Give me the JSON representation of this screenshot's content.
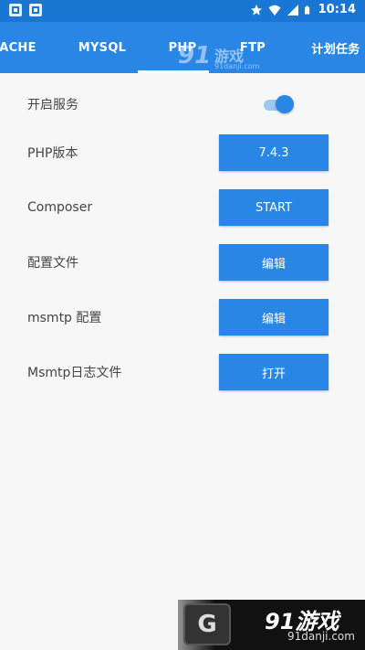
{
  "status_bar": {
    "time": "10:14",
    "notification_icons": [
      "app-notification-icon",
      "app-notification-icon"
    ],
    "right_icons": [
      "star-icon",
      "wifi-icon",
      "signal-icon",
      "battery-icon"
    ]
  },
  "tabs": [
    {
      "label": "APACHE",
      "active": false
    },
    {
      "label": "MYSQL",
      "active": false
    },
    {
      "label": "PHP",
      "active": true
    },
    {
      "label": "FTP",
      "active": false
    },
    {
      "label": "计划任务",
      "active": false
    }
  ],
  "settings": {
    "service_toggle": {
      "label": "开启服务",
      "on": true
    },
    "php_version": {
      "label": "PHP版本",
      "button": "7.4.3"
    },
    "composer": {
      "label": "Composer",
      "button": "START"
    },
    "config_file": {
      "label": "配置文件",
      "button": "编辑"
    },
    "msmtp_config": {
      "label": "msmtp 配置",
      "button": "编辑"
    },
    "msmtp_log": {
      "label": "Msmtp日志文件",
      "button": "打开"
    }
  },
  "watermark": {
    "top_logo": "91",
    "top_name": "游戏",
    "top_url": "91danji.com",
    "bottom_logo": "91",
    "bottom_name": "游戏",
    "bottom_url": "91danji.com"
  },
  "colors": {
    "primary": "#2a86e4",
    "status_bar": "#1976d2",
    "background": "#f7f7f7",
    "switch_track": "#9cc7f2"
  }
}
